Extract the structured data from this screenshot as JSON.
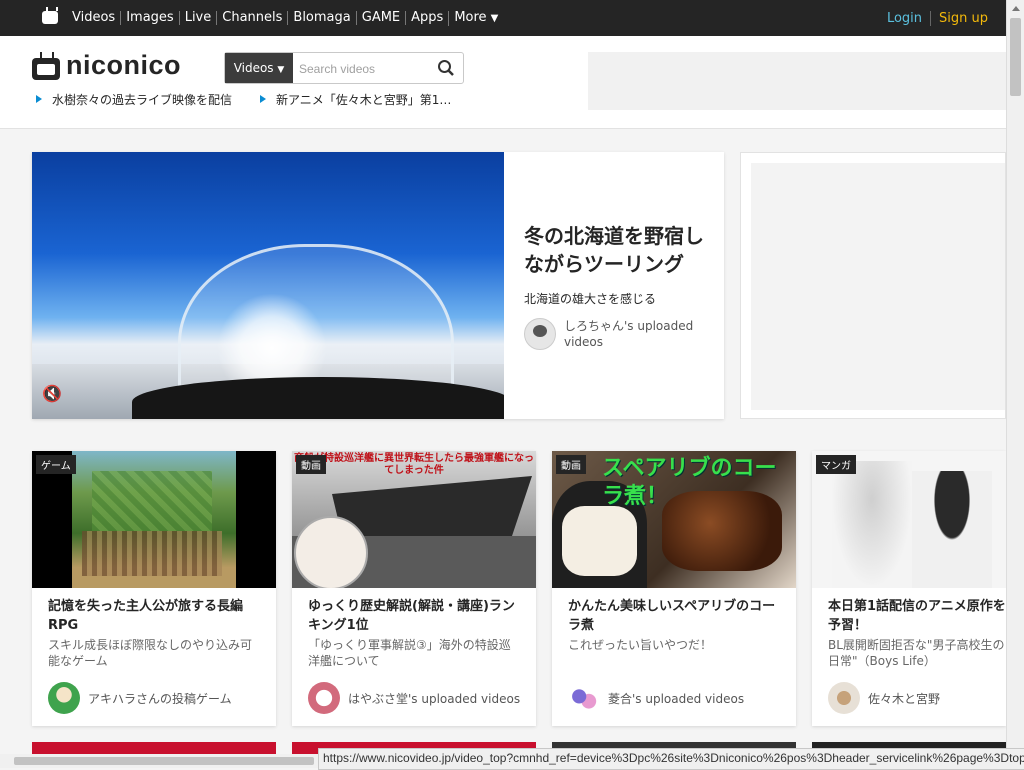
{
  "topnav": {
    "items": [
      "Videos",
      "Images",
      "Live",
      "Channels",
      "Blomaga",
      "GAME",
      "Apps",
      "More"
    ],
    "login": "Login",
    "signup": "Sign up"
  },
  "header": {
    "logo_text": "niconico",
    "search_type": "Videos",
    "search_placeholder": "Search videos",
    "pickups": [
      "水樹奈々の過去ライブ映像を配信",
      "新アニメ「佐々木と宮野」第1…"
    ]
  },
  "hero": {
    "title": "冬の北海道を野宿しながらツーリング",
    "subtitle": "北海道の雄大さを感じる",
    "uploader": "しろちゃん's uploaded videos"
  },
  "cards": [
    {
      "badge": "ゲーム",
      "title": "記憶を失った主人公が旅する長編RPG",
      "desc": "スキル成長ほぼ際限なしのやり込み可能なゲーム",
      "owner": "アキハラさんの投稿ゲーム"
    },
    {
      "badge": "動画",
      "title": "ゆっくり歴史解説(解説・講座)ランキング1位",
      "desc": "「ゆっくり軍事解説③」海外の特設巡洋艦について",
      "owner": "はやぶさ堂's uploaded videos"
    },
    {
      "badge": "動画",
      "title": "かんたん美味しいスペアリブのコーラ煮",
      "desc": "これぜったい旨いやつだ！",
      "owner": "菱合's uploaded videos"
    },
    {
      "badge": "マンガ",
      "title": "本日第1話配信のアニメ原作を予習！",
      "desc": "BL展開断固拒否な\"男子高校生の日常\"（Boys Life）",
      "owner": "佐々木と宮野"
    }
  ],
  "thumb_texts": {
    "card2_overlay": "商船が特設巡洋艦に異世界転生したら最強軍艦になってしまった件",
    "card3_overlay": "スペアリブのコーラ煮！"
  },
  "status_url": "https://www.nicovideo.jp/video_top?cmnhd_ref=device%3Dpc%26site%3Dniconico%26pos%3Dheader_servicelink%26page%3Dtop",
  "colors": {
    "accent": "#0a8cd2",
    "login": "#5bc0de",
    "signup": "#f3b90b",
    "topbar": "#252525"
  }
}
